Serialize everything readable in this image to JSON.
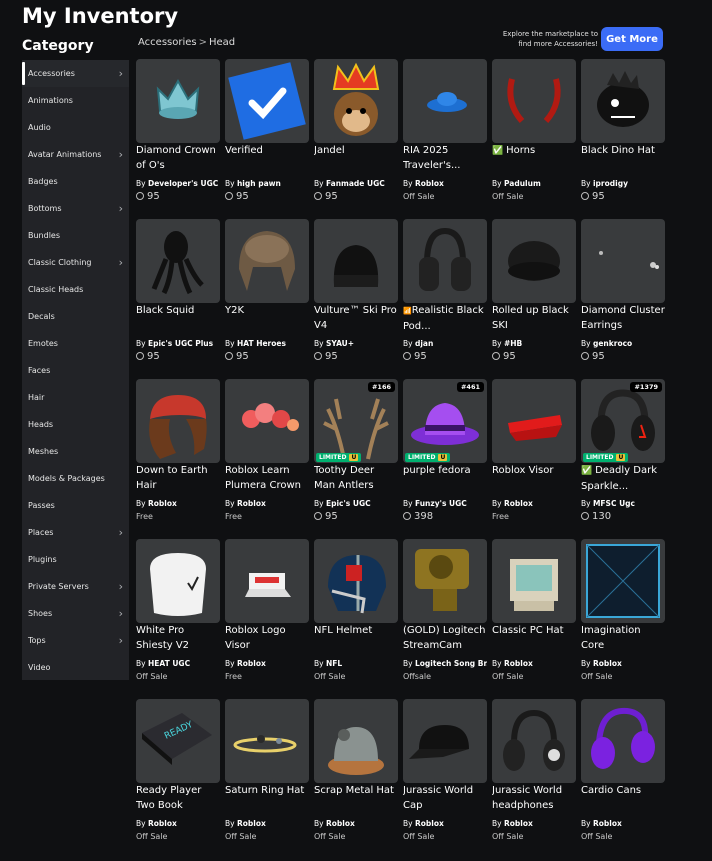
{
  "page": {
    "title": "My Inventory",
    "category_label": "Category"
  },
  "sidebar": {
    "items": [
      {
        "label": "Accessories",
        "chevron": true,
        "active": true
      },
      {
        "label": "Animations",
        "chevron": false
      },
      {
        "label": "Audio",
        "chevron": false
      },
      {
        "label": "Avatar Animations",
        "chevron": true
      },
      {
        "label": "Badges",
        "chevron": false
      },
      {
        "label": "Bottoms",
        "chevron": true
      },
      {
        "label": "Bundles",
        "chevron": false
      },
      {
        "label": "Classic Clothing",
        "chevron": true
      },
      {
        "label": "Classic Heads",
        "chevron": false
      },
      {
        "label": "Decals",
        "chevron": false
      },
      {
        "label": "Emotes",
        "chevron": false
      },
      {
        "label": "Faces",
        "chevron": false
      },
      {
        "label": "Hair",
        "chevron": false
      },
      {
        "label": "Heads",
        "chevron": false
      },
      {
        "label": "Meshes",
        "chevron": false
      },
      {
        "label": "Models & Packages",
        "chevron": false
      },
      {
        "label": "Passes",
        "chevron": false
      },
      {
        "label": "Places",
        "chevron": true
      },
      {
        "label": "Plugins",
        "chevron": false
      },
      {
        "label": "Private Servers",
        "chevron": true
      },
      {
        "label": "Shoes",
        "chevron": true
      },
      {
        "label": "Tops",
        "chevron": true
      },
      {
        "label": "Video",
        "chevron": false
      }
    ]
  },
  "breadcrumb": {
    "parent": "Accessories",
    "separator": ">",
    "current": "Head"
  },
  "promo": {
    "text": "Explore the marketplace to find more Accessories!",
    "button": "Get More",
    "button_color": "#3b6cf6"
  },
  "items": [
    {
      "name": "Diamond Crown of O's",
      "creator": "Developer's UGC",
      "price": "95",
      "icon": "crown-icon"
    },
    {
      "name": "Verified",
      "creator": "high pawn",
      "price": "95",
      "icon": "verified-check-icon"
    },
    {
      "name": "Jandel",
      "creator": "Fanmade UGC",
      "price": "95",
      "icon": "monkey-king-icon"
    },
    {
      "name": "RIA 2025 Traveler's...",
      "creator": "Roblox",
      "status": "Off Sale",
      "icon": "blue-hat-icon"
    },
    {
      "name": "Horns",
      "check": true,
      "creator": "Padulum",
      "status": "Off Sale",
      "icon": "horns-icon"
    },
    {
      "name": "Black Dino Hat",
      "creator": "iprodigy",
      "price": "95",
      "icon": "dino-hat-icon"
    },
    {
      "name": "Black Squid",
      "creator": "Epic's UGC Plus",
      "price": "95",
      "icon": "squid-icon"
    },
    {
      "name": "Y2K",
      "creator": "HAT Heroes",
      "price": "95",
      "icon": "trapper-hat-icon"
    },
    {
      "name": "Vulture™ Ski Pro V4",
      "creator": "SYAU+",
      "price": "95",
      "icon": "ski-beanie-icon"
    },
    {
      "name": "Realistic Black Pod...",
      "prefix": "📶",
      "creator": "djan",
      "price": "95",
      "icon": "headphones-icon"
    },
    {
      "name": "Rolled up Black SKI",
      "creator": "#HB",
      "price": "95",
      "icon": "black-beanie-icon"
    },
    {
      "name": "Diamond Cluster Earrings",
      "creator": "genkroco",
      "price": "95",
      "icon": "earrings-icon"
    },
    {
      "name": "Down to Earth Hair",
      "creator": "Roblox",
      "status": "Free",
      "icon": "hair-icon"
    },
    {
      "name": "Roblox Learn Plumera Crown",
      "creator": "Roblox",
      "status": "Free",
      "icon": "flower-crown-icon"
    },
    {
      "name": "Toothy Deer Man Antlers",
      "creator": "Epic's UGC",
      "price": "95",
      "serial": "#166",
      "limited": true,
      "icon": "antlers-icon"
    },
    {
      "name": "purple fedora",
      "creator": "Funzy's UGC",
      "price": "398",
      "serial": "#461",
      "limited": true,
      "icon": "fedora-icon"
    },
    {
      "name": "Roblox Visor",
      "creator": "Roblox",
      "status": "Free",
      "icon": "visor-icon"
    },
    {
      "name": "Deadly Dark Sparkle...",
      "check": true,
      "creator": "MFSC Ugc",
      "price": "130",
      "serial": "#1379",
      "limited": true,
      "icon": "dark-headphones-icon"
    },
    {
      "name": "White Pro Shiesty V2",
      "creator": "HEAT UGC",
      "status": "Off Sale",
      "icon": "white-mask-icon"
    },
    {
      "name": "Roblox Logo Visor",
      "creator": "Roblox",
      "status": "Free",
      "icon": "logo-visor-icon"
    },
    {
      "name": "NFL Helmet",
      "creator": "NFL",
      "status": "Off Sale",
      "icon": "helmet-icon"
    },
    {
      "name": "(GOLD) Logitech StreamCam",
      "creator": "Logitech Song Br...",
      "status": "Offsale",
      "icon": "webcam-icon"
    },
    {
      "name": "Classic PC Hat",
      "creator": "Roblox",
      "status": "Off Sale",
      "icon": "pc-hat-icon"
    },
    {
      "name": "Imagination Core",
      "creator": "Roblox",
      "status": "Off Sale",
      "icon": "cube-icon"
    },
    {
      "name": "Ready Player Two Book",
      "creator": "Roblox",
      "status": "Off Sale",
      "icon": "book-icon"
    },
    {
      "name": "Saturn Ring Hat",
      "creator": "Roblox",
      "status": "Off Sale",
      "icon": "saturn-ring-icon"
    },
    {
      "name": "Scrap Metal Hat",
      "creator": "Roblox",
      "status": "Off Sale",
      "icon": "scrap-hat-icon"
    },
    {
      "name": "Jurassic World Cap",
      "creator": "Roblox",
      "status": "Off Sale",
      "icon": "cap-icon"
    },
    {
      "name": "Jurassic World headphones",
      "creator": "Roblox",
      "status": "Off Sale",
      "icon": "jw-headphones-icon"
    },
    {
      "name": "Cardio Cans",
      "creator": "Roblox",
      "status": "Off Sale",
      "icon": "purple-earmuffs-icon"
    }
  ],
  "labels": {
    "by": "By",
    "limited": "LIMITED",
    "limited_u": "U"
  }
}
